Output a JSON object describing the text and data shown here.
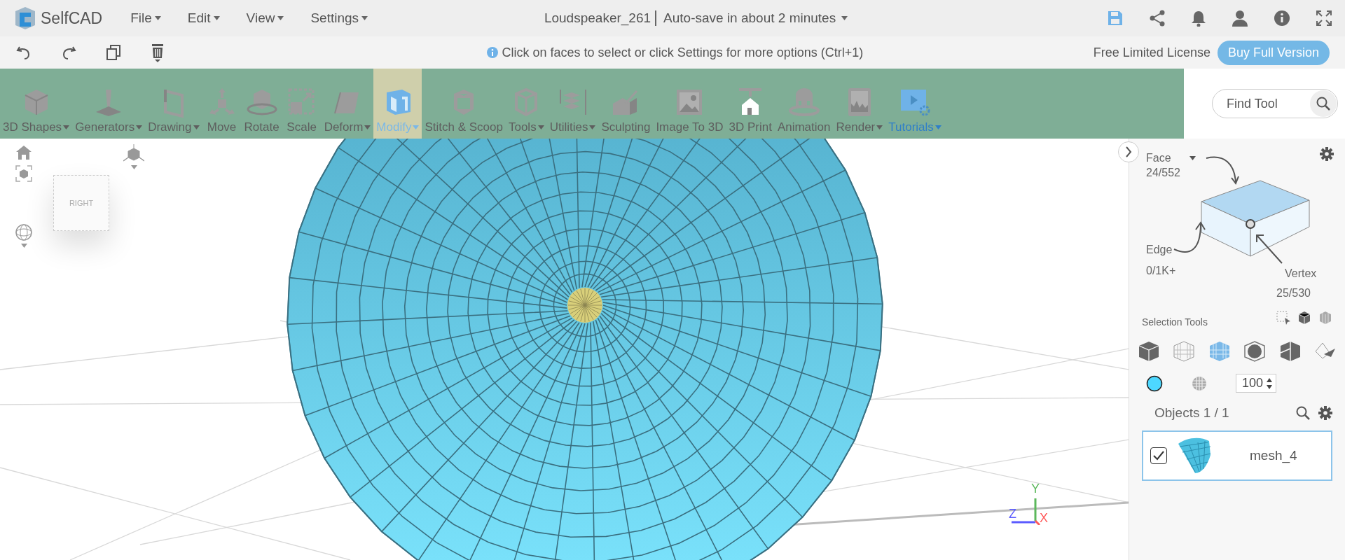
{
  "menu_bar": {
    "app_name": "SelfCAD",
    "menus": [
      {
        "label": "File"
      },
      {
        "label": "Edit"
      },
      {
        "label": "View"
      },
      {
        "label": "Settings"
      }
    ],
    "document_title": "Loudspeaker_261",
    "autosave": "Auto-save in about 2 minutes"
  },
  "action_bar": {
    "hint": "Click on faces to select or click Settings for more options (Ctrl+1)",
    "license": "Free Limited License",
    "buy_button": "Buy Full Version"
  },
  "toolbar": {
    "tools": [
      {
        "label": "3D Shapes",
        "dropdown": true,
        "selected": false,
        "accent": false
      },
      {
        "label": "Generators",
        "dropdown": true,
        "selected": false,
        "accent": false
      },
      {
        "label": "Drawing",
        "dropdown": true,
        "selected": false,
        "accent": false
      },
      {
        "label": "Move",
        "dropdown": false,
        "selected": false,
        "accent": false
      },
      {
        "label": "Rotate",
        "dropdown": false,
        "selected": false,
        "accent": false
      },
      {
        "label": "Scale",
        "dropdown": false,
        "selected": false,
        "accent": false
      },
      {
        "label": "Deform",
        "dropdown": true,
        "selected": false,
        "accent": false
      },
      {
        "label": "Modify",
        "dropdown": true,
        "selected": true,
        "accent": false
      },
      {
        "label": "Stitch & Scoop",
        "dropdown": false,
        "selected": false,
        "accent": false
      },
      {
        "label": "Tools",
        "dropdown": true,
        "selected": false,
        "accent": false
      },
      {
        "label": "Utilities",
        "dropdown": true,
        "selected": false,
        "accent": false
      },
      {
        "label": "Sculpting",
        "dropdown": false,
        "selected": false,
        "accent": false
      },
      {
        "label": "Image To 3D",
        "dropdown": false,
        "selected": false,
        "accent": false
      },
      {
        "label": "3D Print",
        "dropdown": false,
        "selected": false,
        "accent": false
      },
      {
        "label": "Animation",
        "dropdown": false,
        "selected": false,
        "accent": false
      },
      {
        "label": "Render",
        "dropdown": true,
        "selected": false,
        "accent": false
      },
      {
        "label": "Tutorials",
        "dropdown": true,
        "selected": false,
        "accent": true
      }
    ],
    "search": {
      "placeholder": "Find Tool"
    }
  },
  "viewport": {
    "view_cube_label": "RIGHT",
    "axes": {
      "x": "X",
      "y": "Y",
      "z": "Z"
    }
  },
  "panel": {
    "mode": "Face",
    "face_count": "24/552",
    "edge_label": "Edge",
    "edge_count": "0/1K+",
    "vertex_label": "Vertex",
    "vertex_count": "25/530",
    "selection_tools_label": "Selection Tools",
    "color": "#4dd8ff",
    "opacity": "100",
    "objects_label": "Objects 1 / 1",
    "objects": [
      {
        "name": "mesh_4",
        "checked": true,
        "selected": true
      }
    ]
  }
}
